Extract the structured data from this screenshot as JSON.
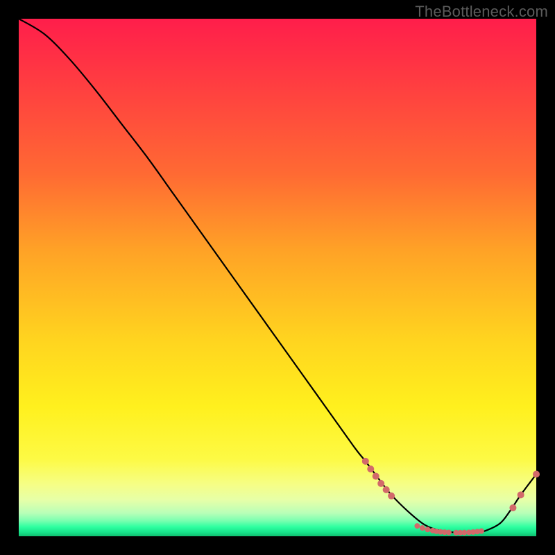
{
  "watermark": "TheBottleneck.com",
  "chart_data": {
    "type": "line",
    "title": "",
    "xlabel": "",
    "ylabel": "",
    "xlim": [
      0,
      100
    ],
    "ylim": [
      0,
      100
    ],
    "grid": false,
    "series": [
      {
        "name": "bottleneck-curve",
        "x": [
          0,
          5,
          10,
          15,
          20,
          25,
          30,
          35,
          40,
          45,
          50,
          55,
          60,
          65,
          67,
          70,
          72,
          75,
          78,
          80,
          82,
          85,
          88,
          90,
          93,
          95,
          97,
          100
        ],
        "values": [
          100,
          97,
          92,
          86,
          79.5,
          73,
          66,
          59,
          52,
          45,
          38,
          31,
          24,
          17,
          14.5,
          10.5,
          8,
          5,
          2.5,
          1.5,
          1,
          0.7,
          0.7,
          1,
          2.5,
          5,
          8,
          12
        ],
        "color": "#000000"
      }
    ],
    "markers": [
      {
        "x": 67,
        "y": 14.5,
        "r": 5
      },
      {
        "x": 68,
        "y": 13.0,
        "r": 5
      },
      {
        "x": 69,
        "y": 11.6,
        "r": 5
      },
      {
        "x": 70,
        "y": 10.2,
        "r": 5
      },
      {
        "x": 71,
        "y": 9.0,
        "r": 5
      },
      {
        "x": 72,
        "y": 7.8,
        "r": 5
      },
      {
        "x": 77,
        "y": 2.0,
        "r": 4
      },
      {
        "x": 78,
        "y": 1.6,
        "r": 4
      },
      {
        "x": 79,
        "y": 1.3,
        "r": 4
      },
      {
        "x": 80,
        "y": 1.1,
        "r": 4
      },
      {
        "x": 80.7,
        "y": 0.95,
        "r": 4
      },
      {
        "x": 81.5,
        "y": 0.85,
        "r": 4
      },
      {
        "x": 82.3,
        "y": 0.78,
        "r": 4
      },
      {
        "x": 83.1,
        "y": 0.74,
        "r": 4
      },
      {
        "x": 84.5,
        "y": 0.7,
        "r": 4
      },
      {
        "x": 85.3,
        "y": 0.7,
        "r": 4
      },
      {
        "x": 86.1,
        "y": 0.72,
        "r": 4
      },
      {
        "x": 87.0,
        "y": 0.76,
        "r": 4
      },
      {
        "x": 87.8,
        "y": 0.82,
        "r": 4
      },
      {
        "x": 88.6,
        "y": 0.9,
        "r": 4
      },
      {
        "x": 89.4,
        "y": 1.0,
        "r": 4
      },
      {
        "x": 95.5,
        "y": 5.5,
        "r": 5
      },
      {
        "x": 97.0,
        "y": 8.0,
        "r": 5
      },
      {
        "x": 100.0,
        "y": 12.0,
        "r": 5
      }
    ],
    "marker_color": "#d2696a"
  }
}
